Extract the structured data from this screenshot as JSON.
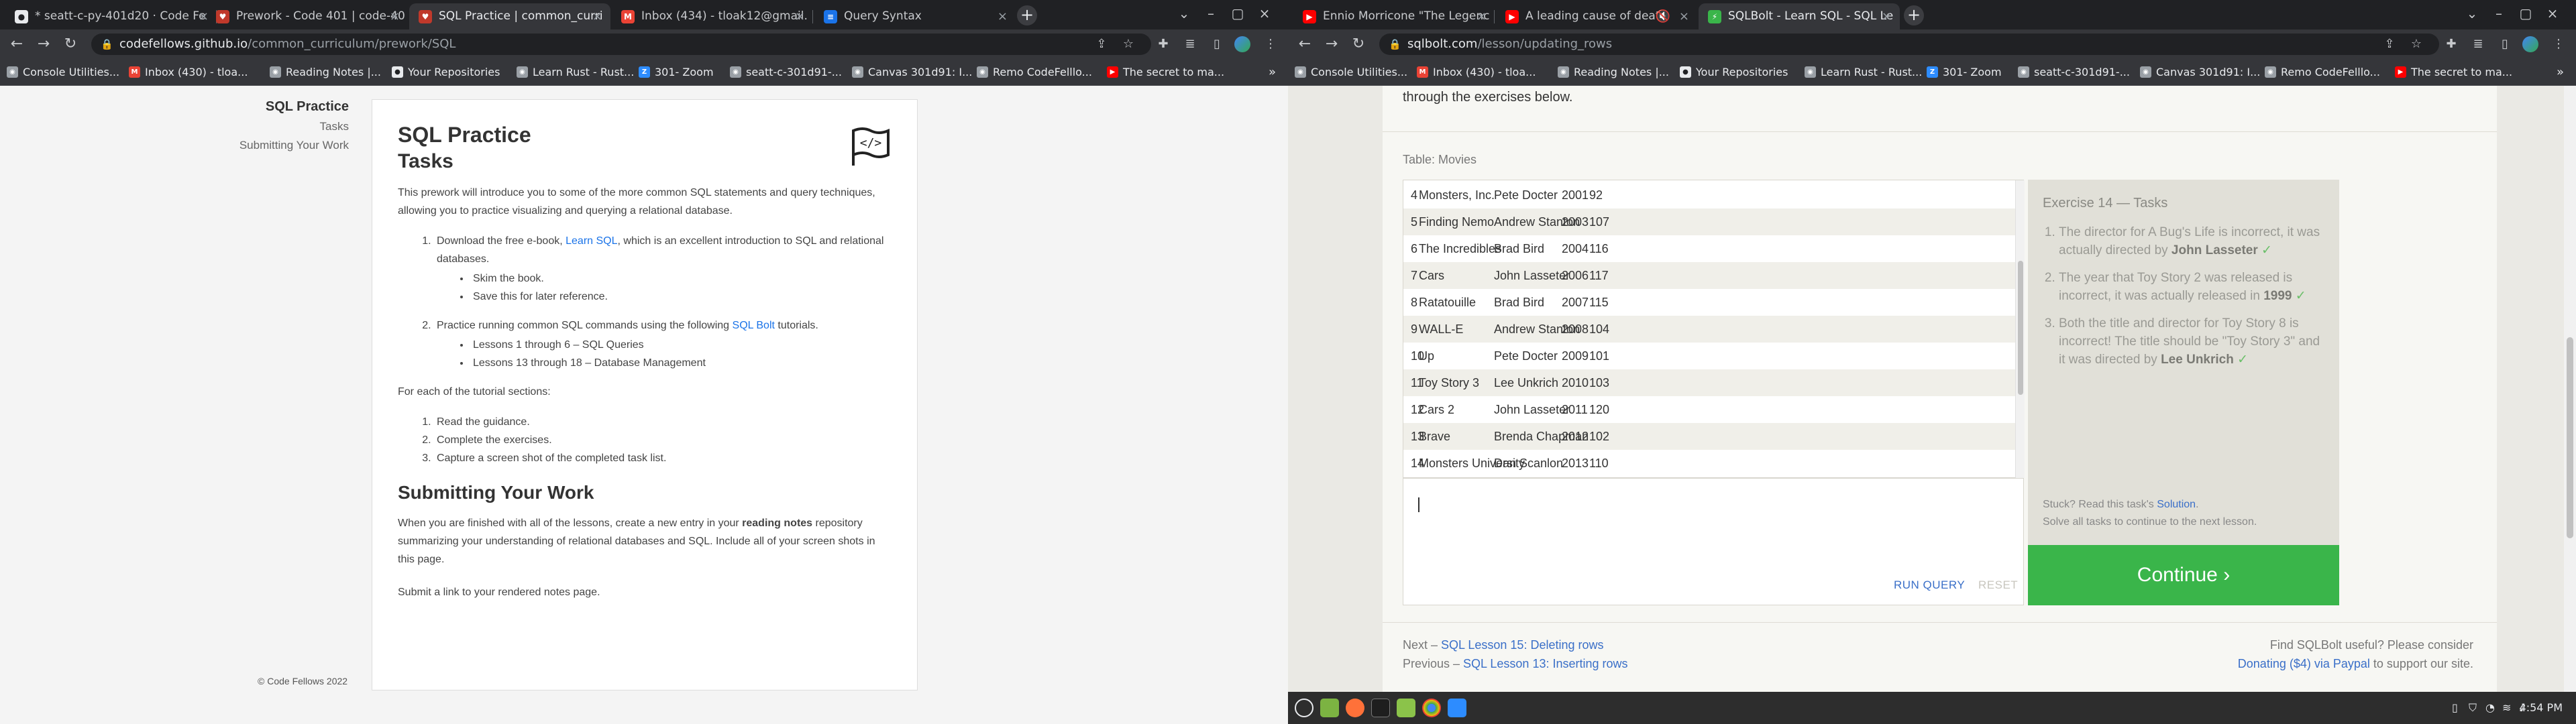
{
  "left_window": {
    "tabs": [
      {
        "title": "* seatt-c-py-401d20 · Code Fe",
        "favicon": "github-icon",
        "color": "#e8eaed"
      },
      {
        "title": "Prework - Code 401 | code-40",
        "favicon": "codefellows-icon",
        "color": "#c0392b"
      },
      {
        "title": "SQL Practice | common_curri",
        "favicon": "codefellows-icon",
        "color": "#c0392b"
      },
      {
        "title": "Inbox (434) - tloak12@gmail.",
        "favicon": "gmail-icon",
        "color": "#ea4335"
      },
      {
        "title": "Query Syntax",
        "favicon": "docs-icon",
        "color": "#1a73e8"
      }
    ],
    "url_host": "codefellows.github.io",
    "url_path": "/common_curriculum/prework/SQL",
    "bookmarks": [
      "Console Utilities...",
      "Inbox (430) - tloa...",
      "Reading Notes |...",
      "Your Repositories",
      "Learn Rust - Rust...",
      "301- Zoom",
      "seatt-c-301d91-...",
      "Canvas 301d91: I...",
      "Remo CodeFelllo...",
      "The secret to ma..."
    ],
    "side_nav": {
      "title": "SQL Practice",
      "items": [
        "Tasks",
        "Submitting Your Work"
      ]
    },
    "doc": {
      "title": "SQL Practice",
      "h_tasks": "Tasks",
      "intro": "This prework will introduce you to some of the more common SQL statements and query techniques, allowing you to practice visualizing and querying a relational database.",
      "step1_pre": "Download the free e-book, ",
      "step1_link": "Learn SQL",
      "step1_post": ", which is an excellent introduction to SQL and relational databases.",
      "step1_sub": [
        "Skim the book.",
        "Save this for later reference."
      ],
      "step2_pre": "Practice running common SQL commands using the following ",
      "step2_link": "SQL Bolt",
      "step2_post": " tutorials.",
      "step2_sub": [
        "Lessons 1 through 6 – SQL Queries",
        "Lessons 13 through 18 – Database Management"
      ],
      "for_each": "For each of the tutorial sections:",
      "steps": [
        "Read the guidance.",
        "Complete the exercises.",
        "Capture a screen shot of the completed task list."
      ],
      "h_submit": "Submitting Your Work",
      "submit_pre": "When you are finished with all of the lessons, create a new entry in your ",
      "submit_bold": "reading notes",
      "submit_post": " repository summarizing your understanding of relational databases and SQL. Include all of your screen shots in this page.",
      "submit_link": "Submit a link to your rendered notes page."
    },
    "footer": "© Code Fellows 2022"
  },
  "right_window": {
    "tabs": [
      {
        "title": "Ennio Morricone \"The Legenc",
        "favicon": "youtube-icon",
        "color": "#ff0000"
      },
      {
        "title": "A leading cause of death",
        "favicon": "youtube-icon",
        "color": "#ff0000"
      },
      {
        "title": "SQLBolt - Learn SQL - SQL Le",
        "favicon": "sqlbolt-icon",
        "color": "#3ab54a"
      }
    ],
    "url_host": "sqlbolt.com",
    "url_path": "/lesson/updating_rows",
    "bookmarks": [
      "Console Utilities...",
      "Inbox (430) - tloa...",
      "Reading Notes |...",
      "Your Repositories",
      "Learn Rust - Rust...",
      "301- Zoom",
      "seatt-c-301d91-...",
      "Canvas 301d91: I...",
      "Remo CodeFelllo...",
      "The secret to ma..."
    ],
    "intro_tail": "through the exercises below.",
    "table_label": "Table: Movies",
    "movies": [
      [
        "4",
        "Monsters, Inc.",
        "Pete Docter",
        "2001",
        "92"
      ],
      [
        "5",
        "Finding Nemo",
        "Andrew Stanton",
        "2003",
        "107"
      ],
      [
        "6",
        "The Incredibles",
        "Brad Bird",
        "2004",
        "116"
      ],
      [
        "7",
        "Cars",
        "John Lasseter",
        "2006",
        "117"
      ],
      [
        "8",
        "Ratatouille",
        "Brad Bird",
        "2007",
        "115"
      ],
      [
        "9",
        "WALL-E",
        "Andrew Stanton",
        "2008",
        "104"
      ],
      [
        "10",
        "Up",
        "Pete Docter",
        "2009",
        "101"
      ],
      [
        "11",
        "Toy Story 3",
        "Lee Unkrich",
        "2010",
        "103"
      ],
      [
        "12",
        "Cars 2",
        "John Lasseter",
        "2011",
        "120"
      ],
      [
        "13",
        "Brave",
        "Brenda Chapman",
        "2012",
        "102"
      ],
      [
        "14",
        "Monsters University",
        "Dan Scanlon",
        "2013",
        "110"
      ]
    ],
    "run_label": "RUN QUERY",
    "reset_label": "RESET",
    "tasks_title": "Exercise 14 — Tasks",
    "tasks": [
      {
        "pre": "The director for A Bug's Life is incorrect, it was actually directed by ",
        "bold": "John Lasseter"
      },
      {
        "pre": "The year that Toy Story 2 was released is incorrect, it was actually released in ",
        "bold": "1999"
      },
      {
        "pre": "Both the title and director for Toy Story 8 is incorrect! The title should be \"Toy Story 3\" and it was directed by ",
        "bold": "Lee Unkrich"
      }
    ],
    "check": "✓",
    "stuck_pre": "Stuck? Read this task's ",
    "stuck_link": "Solution",
    "stuck_post": ".",
    "solve_all": "Solve all tasks to continue to the next lesson.",
    "continue_label": "Continue ›",
    "next_pre": "Next – ",
    "next_link": "SQL Lesson 15: Deleting rows",
    "prev_pre": "Previous – ",
    "prev_link": "SQL Lesson 13: Inserting rows",
    "support_line": "Find SQLBolt useful? Please consider",
    "support_link": "Donating ($4) via Paypal",
    "support_post": " to support our site."
  },
  "taskbar": {
    "clock": "4:54 PM",
    "apps": [
      "menu-icon",
      "files-icon",
      "firefox-icon",
      "terminal-icon",
      "folder-icon",
      "chrome-icon",
      "zoom-icon"
    ]
  }
}
